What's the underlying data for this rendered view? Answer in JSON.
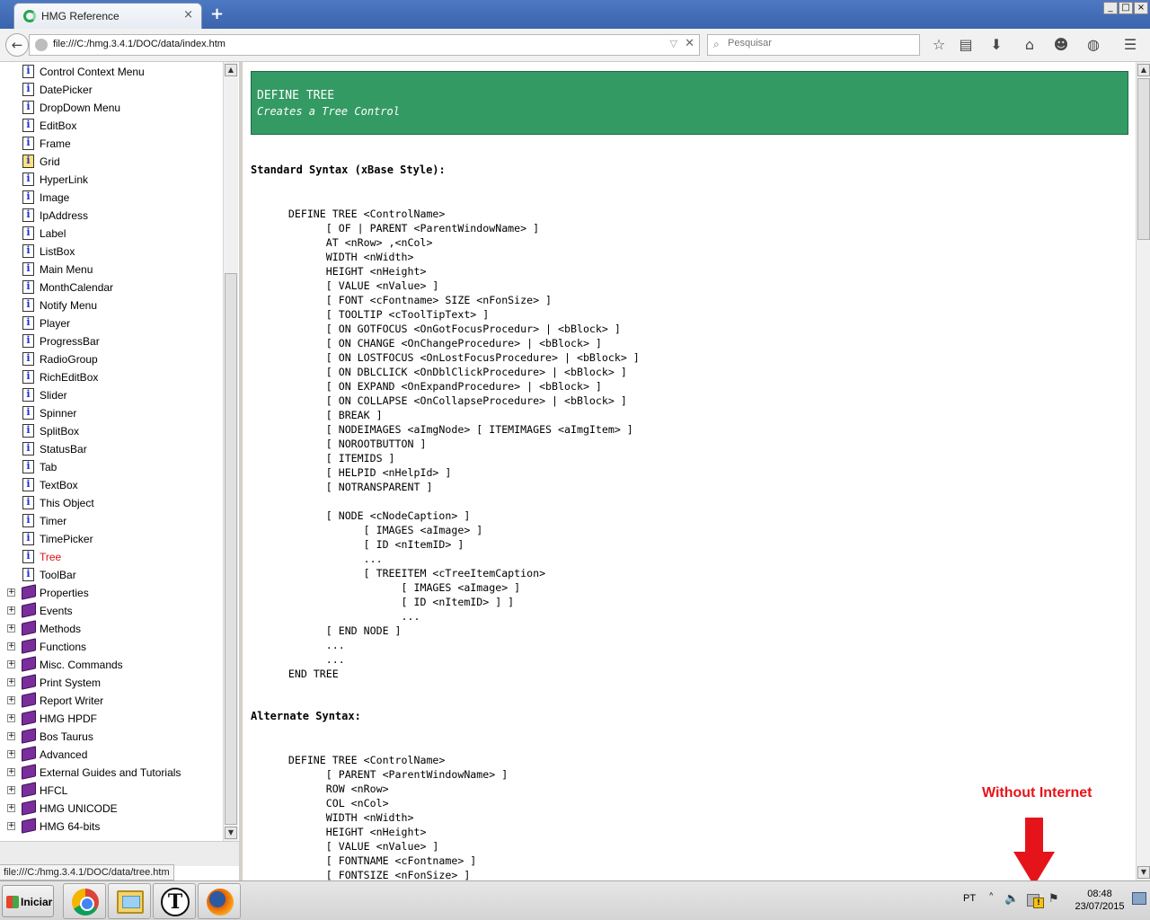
{
  "browser": {
    "tab_title": "HMG Reference",
    "tab_close": "×",
    "new_tab": "+",
    "url": "file:///C:/hmg.3.4.1/DOC/data/index.htm",
    "search_placeholder": "Pesquisar",
    "window_buttons": [
      "_",
      "□",
      "×"
    ]
  },
  "sidebar": {
    "items": [
      {
        "label": "Control Context Menu",
        "icon": "page-icon",
        "expander": false
      },
      {
        "label": "DatePicker",
        "icon": "page-icon",
        "expander": false
      },
      {
        "label": "DropDown Menu",
        "icon": "page-icon",
        "expander": false
      },
      {
        "label": "EditBox",
        "icon": "page-icon",
        "expander": false
      },
      {
        "label": "Frame",
        "icon": "page-icon",
        "expander": false
      },
      {
        "label": "Grid",
        "icon": "page-icon-yellow",
        "expander": false
      },
      {
        "label": "HyperLink",
        "icon": "page-icon",
        "expander": false
      },
      {
        "label": "Image",
        "icon": "page-icon",
        "expander": false
      },
      {
        "label": "IpAddress",
        "icon": "page-icon",
        "expander": false
      },
      {
        "label": "Label",
        "icon": "page-icon",
        "expander": false
      },
      {
        "label": "ListBox",
        "icon": "page-icon",
        "expander": false
      },
      {
        "label": "Main Menu",
        "icon": "page-icon",
        "expander": false
      },
      {
        "label": "MonthCalendar",
        "icon": "page-icon",
        "expander": false
      },
      {
        "label": "Notify Menu",
        "icon": "page-icon",
        "expander": false
      },
      {
        "label": "Player",
        "icon": "page-icon",
        "expander": false
      },
      {
        "label": "ProgressBar",
        "icon": "page-icon",
        "expander": false
      },
      {
        "label": "RadioGroup",
        "icon": "page-icon",
        "expander": false
      },
      {
        "label": "RichEditBox",
        "icon": "page-icon",
        "expander": false
      },
      {
        "label": "Slider",
        "icon": "page-icon",
        "expander": false
      },
      {
        "label": "Spinner",
        "icon": "page-icon",
        "expander": false
      },
      {
        "label": "SplitBox",
        "icon": "page-icon",
        "expander": false
      },
      {
        "label": "StatusBar",
        "icon": "page-icon",
        "expander": false
      },
      {
        "label": "Tab",
        "icon": "page-icon",
        "expander": false
      },
      {
        "label": "TextBox",
        "icon": "page-icon",
        "expander": false
      },
      {
        "label": "This Object",
        "icon": "page-icon",
        "expander": false
      },
      {
        "label": "Timer",
        "icon": "page-icon",
        "expander": false
      },
      {
        "label": "TimePicker",
        "icon": "page-icon",
        "expander": false
      },
      {
        "label": "Tree",
        "icon": "page-icon",
        "expander": false,
        "active": true
      },
      {
        "label": "ToolBar",
        "icon": "page-icon",
        "expander": false
      },
      {
        "label": "Properties",
        "icon": "book-icon",
        "expander": true
      },
      {
        "label": "Events",
        "icon": "book-icon",
        "expander": true
      },
      {
        "label": "Methods",
        "icon": "book-icon",
        "expander": true
      },
      {
        "label": "Functions",
        "icon": "book-icon",
        "expander": true
      },
      {
        "label": "Misc. Commands",
        "icon": "book-icon",
        "expander": true
      },
      {
        "label": "Print System",
        "icon": "book-icon",
        "expander": true
      },
      {
        "label": "Report Writer",
        "icon": "book-icon",
        "expander": true
      },
      {
        "label": "HMG HPDF",
        "icon": "book-icon",
        "expander": true
      },
      {
        "label": "Bos Taurus",
        "icon": "book-icon",
        "expander": true
      },
      {
        "label": "Advanced",
        "icon": "book-icon",
        "expander": true
      },
      {
        "label": "External Guides and Tutorials",
        "icon": "book-icon",
        "expander": true
      },
      {
        "label": "HFCL",
        "icon": "book-icon",
        "expander": true
      },
      {
        "label": "HMG UNICODE",
        "icon": "book-icon",
        "expander": true
      },
      {
        "label": "HMG 64-bits",
        "icon": "book-icon",
        "expander": true
      }
    ]
  },
  "content": {
    "title": "DEFINE TREE",
    "subtitle": "Creates a Tree Control",
    "standard_heading": "Standard Syntax (xBase Style):",
    "standard_code": "      DEFINE TREE <ControlName>\n            [ OF | PARENT <ParentWindowName> ]\n            AT <nRow> ,<nCol>\n            WIDTH <nWidth>\n            HEIGHT <nHeight>\n            [ VALUE <nValue> ]\n            [ FONT <cFontname> SIZE <nFonSize> ]\n            [ TOOLTIP <cToolTipText> ]\n            [ ON GOTFOCUS <OnGotFocusProcedur> | <bBlock> ]\n            [ ON CHANGE <OnChangeProcedure> | <bBlock> ]\n            [ ON LOSTFOCUS <OnLostFocusProcedure> | <bBlock> ]\n            [ ON DBLCLICK <OnDblClickProcedure> | <bBlock> ]\n            [ ON EXPAND <OnExpandProcedure> | <bBlock> ]\n            [ ON COLLAPSE <OnCollapseProcedure> | <bBlock> ]\n            [ BREAK ]\n            [ NODEIMAGES <aImgNode> [ ITEMIMAGES <aImgItem> ]\n            [ NOROOTBUTTON ]\n            [ ITEMIDS ]\n            [ HELPID <nHelpId> ]\n            [ NOTRANSPARENT ]\n\n            [ NODE <cNodeCaption> ]\n                  [ IMAGES <aImage> ]\n                  [ ID <nItemID> ]\n                  ...\n                  [ TREEITEM <cTreeItemCaption>\n                        [ IMAGES <aImage> ]\n                        [ ID <nItemID> ] ]\n                        ...\n            [ END NODE ]\n            ...\n            ...\n      END TREE",
    "alternate_heading": "Alternate Syntax:",
    "alternate_code": "      DEFINE TREE <ControlName>\n            [ PARENT <ParentWindowName> ]\n            ROW <nRow>\n            COL <nCol>\n            WIDTH <nWidth>\n            HEIGHT <nHeight>\n            [ VALUE <nValue> ]\n            [ FONTNAME <cFontname> ]\n            [ FONTSIZE <nFonSize> ]"
  },
  "status_url": "file:///C:/hmg.3.4.1/DOC/data/tree.htm",
  "annotation": {
    "text": "Without Internet",
    "color": "#e5141a"
  },
  "taskbar": {
    "start_label": "Iniciar",
    "apps": [
      "chrome-icon",
      "explorer-icon",
      "t-app-icon",
      "firefox-icon"
    ],
    "t_app_letter": "T",
    "language": "PT",
    "time": "08:48",
    "date": "23/07/2015"
  },
  "colors": {
    "banner": "#349a63",
    "active_item": "#e01010",
    "annotation": "#e5141a"
  }
}
